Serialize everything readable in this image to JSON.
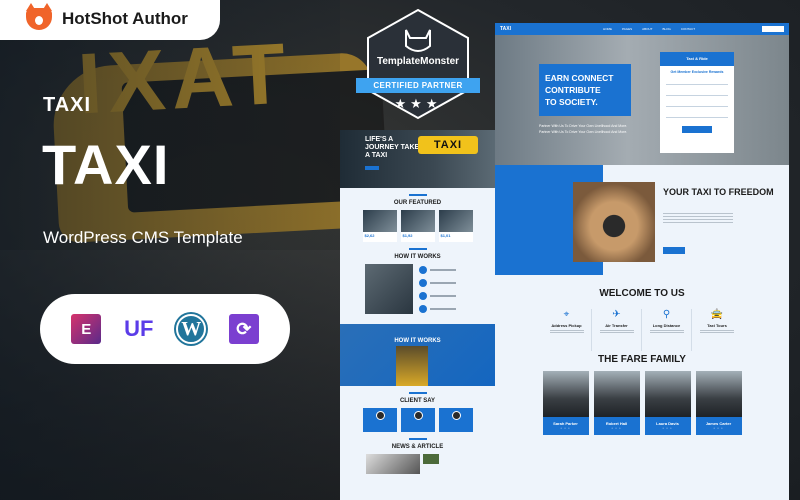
{
  "author": {
    "name": "HotShot Author"
  },
  "hero": {
    "brand_small": "TAXI",
    "title": "TAXI",
    "subtitle": "WordPress CMS Template",
    "bg_sign_text": "IXAT"
  },
  "plugins": [
    {
      "name": "Elementor",
      "glyph": "E"
    },
    {
      "name": "UiCore Framework",
      "glyph": "UF"
    },
    {
      "name": "WordPress",
      "glyph": "W"
    },
    {
      "name": "Updates",
      "glyph": "⟳"
    }
  ],
  "badge": {
    "brand": "TemplateMonster",
    "ribbon": "CERTIFIED PARTNER",
    "stars": "★★★"
  },
  "mock_mid": {
    "hero_title": "LIFE'S A JOURNEY TAKE A TAXI",
    "taxi_sign": "TAXI",
    "featured_title": "OUR FEATURED",
    "featured_prices": [
      "$2,62",
      "$1,92",
      "$1,01"
    ],
    "how_it_works_title": "HOW IT WORKS",
    "how_it_works_title_2": "HOW IT WORKS",
    "client_title": "CLIENT SAY",
    "news_title": "NEWS & ARTICLE"
  },
  "mock_right": {
    "logo": "TAXI",
    "menu": [
      "HOME",
      "PAGES",
      "ABOUT",
      "BLOG",
      "CONTACT"
    ],
    "hero_lines": [
      "EARN CONNECT",
      "CONTRIBUTE",
      "TO SOCIETY."
    ],
    "hero_paragraph": "Partner With Us To Drive Your Own Livelihood And More. Partner With Us To Drive Your Own Livelihood And More.",
    "form_head": "Taxi & Ride",
    "form_sub": "Get Member Exclusive Rewards",
    "freedom_title": "YOUR TAXI TO FREEDOM",
    "welcome_title": "WELCOME TO US",
    "services": [
      {
        "name": "Address Pickup",
        "icon": "⌖"
      },
      {
        "name": "Air Transfer",
        "icon": "✈"
      },
      {
        "name": "Long Distance",
        "icon": "⚲"
      },
      {
        "name": "Taxi Tours",
        "icon": "🚖"
      }
    ],
    "team_title": "THE FARE FAMILY",
    "team": [
      {
        "name": "Sarah Parker"
      },
      {
        "name": "Robert Hall"
      },
      {
        "name": "Laura Davis"
      },
      {
        "name": "James Carter"
      }
    ],
    "social": "• • •"
  }
}
